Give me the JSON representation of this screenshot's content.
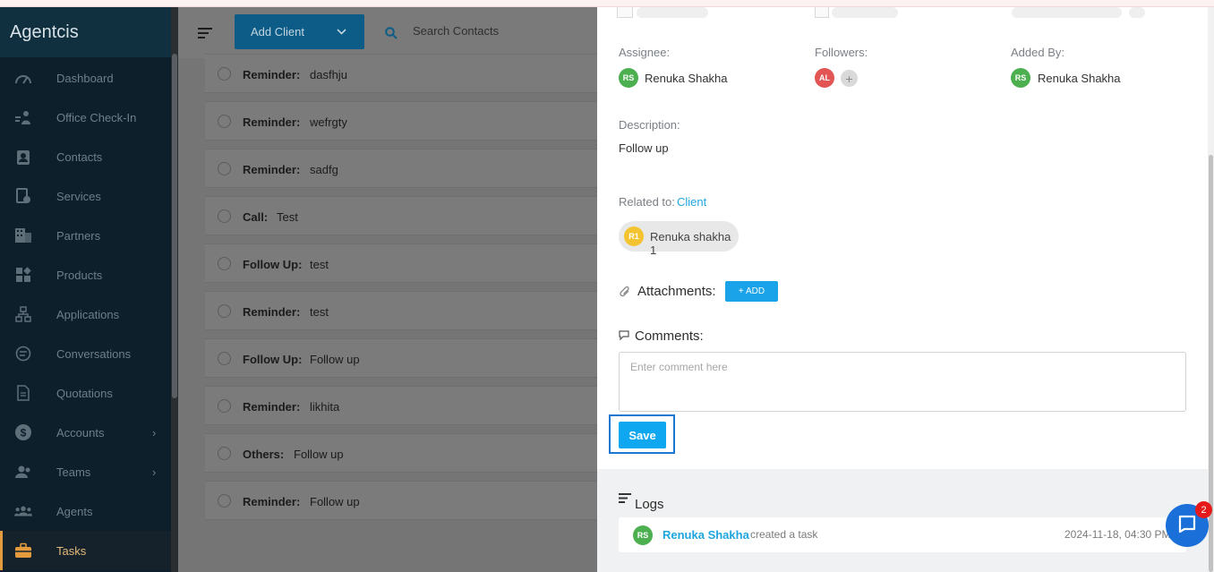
{
  "sidebar": {
    "brand": "Agentcis",
    "items": [
      {
        "label": "Dashboard",
        "icon": "dashboard-icon"
      },
      {
        "label": "Office Check-In",
        "icon": "check-in-icon"
      },
      {
        "label": "Contacts",
        "icon": "contacts-icon"
      },
      {
        "label": "Services",
        "icon": "services-icon"
      },
      {
        "label": "Partners",
        "icon": "partners-icon"
      },
      {
        "label": "Products",
        "icon": "products-icon"
      },
      {
        "label": "Applications",
        "icon": "applications-icon"
      },
      {
        "label": "Conversations",
        "icon": "conversations-icon"
      },
      {
        "label": "Quotations",
        "icon": "quotations-icon"
      },
      {
        "label": "Accounts",
        "icon": "accounts-icon",
        "has_submenu": true
      },
      {
        "label": "Teams",
        "icon": "teams-icon",
        "has_submenu": true
      },
      {
        "label": "Agents",
        "icon": "agents-icon"
      },
      {
        "label": "Tasks",
        "icon": "tasks-icon",
        "active": true
      }
    ]
  },
  "header": {
    "add_client_label": "Add Client",
    "search_placeholder": "Search Contacts"
  },
  "tasks": [
    {
      "type": "Reminder:",
      "title": "dasfhju"
    },
    {
      "type": "Reminder:",
      "title": "wefrgty"
    },
    {
      "type": "Reminder:",
      "title": "sadfg"
    },
    {
      "type": "Call:",
      "title": "Test"
    },
    {
      "type": "Follow Up:",
      "title": "test"
    },
    {
      "type": "Reminder:",
      "title": "test"
    },
    {
      "type": "Follow Up:",
      "title": "Follow up"
    },
    {
      "type": "Reminder:",
      "title": "likhita"
    },
    {
      "type": "Others:",
      "title": "Follow up"
    },
    {
      "type": "Reminder:",
      "title": "Follow up"
    }
  ],
  "detail": {
    "assignee_label": "Assignee:",
    "assignee": {
      "initials": "RS",
      "name": "Renuka Shakha"
    },
    "followers_label": "Followers:",
    "followers": [
      {
        "initials": "AL"
      }
    ],
    "followers_add": "+",
    "added_by_label": "Added By:",
    "added_by": {
      "initials": "RS",
      "name": "Renuka Shakha"
    },
    "description_label": "Description:",
    "description": "Follow up",
    "related_label": "Related to:",
    "related_type": "Client",
    "related_client": {
      "initials": "R1",
      "name": "Renuka shakha 1"
    },
    "attachments_label": "Attachments:",
    "attachments_add": "+ ADD",
    "comments_label": "Comments:",
    "comment_placeholder": "Enter comment here",
    "save_label": "Save",
    "logs_label": "Logs",
    "logs": [
      {
        "initials": "RS",
        "user": "Renuka Shakha",
        "action": "created a task",
        "timestamp": "2024-11-18, 04:30 PM"
      }
    ]
  },
  "chat": {
    "badge": "2"
  },
  "colors": {
    "sidebar_bg": "#0c1f2b",
    "active_accent": "#e39b3d",
    "primary": "#0fa7f0",
    "link": "#1ea5e0",
    "avatar_green": "#4caf50",
    "avatar_red": "#e35454",
    "avatar_yellow": "#f4c430"
  }
}
